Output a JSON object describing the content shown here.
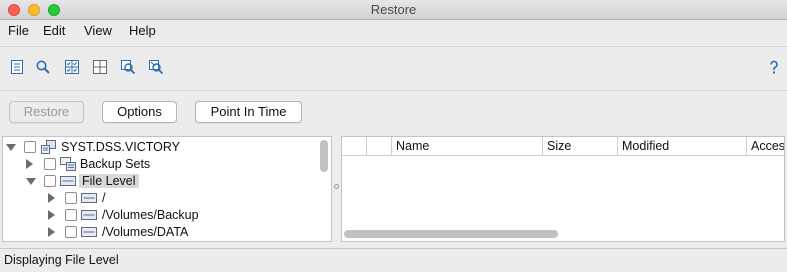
{
  "window": {
    "title": "Restore"
  },
  "menu": {
    "items": [
      "File",
      "Edit",
      "View",
      "Help"
    ]
  },
  "toolbar": {
    "icons": [
      "document-list-icon",
      "search-icon",
      "select-all-grid-icon",
      "grid-view-icon",
      "find-selected-icon",
      "clear-search-icon",
      "help-icon"
    ],
    "accent": "#2b6cb0"
  },
  "buttons": {
    "restore": "Restore",
    "options": "Options",
    "point_in_time": "Point In Time"
  },
  "tree": {
    "root": "SYST.DSS.VICTORY",
    "backup_sets": "Backup Sets",
    "file_level": "File Level",
    "children": [
      "/",
      "/Volumes/Backup",
      "/Volumes/DATA"
    ]
  },
  "table": {
    "columns": [
      "",
      "",
      "Name",
      "Size",
      "Modified",
      "Acces"
    ]
  },
  "status": {
    "text": "Displaying File Level"
  }
}
